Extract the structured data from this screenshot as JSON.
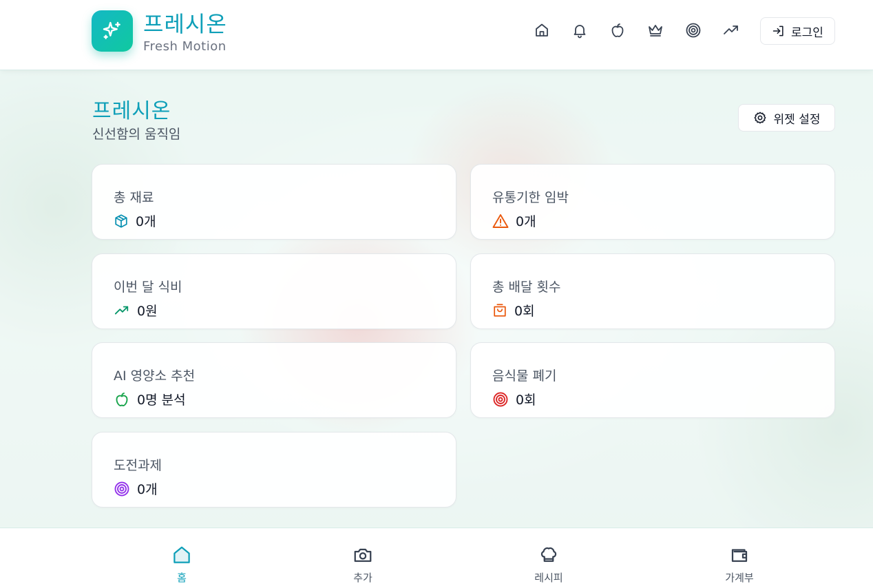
{
  "header": {
    "brand_title": "프레시온",
    "brand_subtitle": "Fresh Motion",
    "nav_icons": [
      "home-icon",
      "bell-icon",
      "apple-icon",
      "crown-icon",
      "target-icon",
      "trending-up-icon"
    ],
    "login_label": "로그인"
  },
  "page": {
    "title": "프레시온",
    "subtitle": "신선함의 움직임",
    "widget_settings_label": "위젯 설정"
  },
  "cards": [
    {
      "label": "총 재료",
      "value": "0개",
      "icon": "box-icon",
      "color": "#0891b2"
    },
    {
      "label": "유통기한 임박",
      "value": "0개",
      "icon": "warning-icon",
      "color": "#ea580c"
    },
    {
      "label": "이번 달 식비",
      "value": "0원",
      "icon": "trending-up-icon",
      "color": "#059669"
    },
    {
      "label": "총 배달 횟수",
      "value": "0회",
      "icon": "shopping-bag-icon",
      "color": "#ea580c"
    },
    {
      "label": "AI 영양소 추천",
      "value": "0명 분석",
      "icon": "apple-icon",
      "color": "#16a34a"
    },
    {
      "label": "음식물 폐기",
      "value": "0회",
      "icon": "target-icon",
      "color": "#dc2626"
    },
    {
      "label": "도전과제",
      "value": "0개",
      "icon": "target-icon",
      "color": "#9333ea"
    }
  ],
  "bottom_nav": [
    {
      "label": "홈",
      "icon": "home-icon",
      "active": true
    },
    {
      "label": "추가",
      "icon": "camera-icon",
      "active": false
    },
    {
      "label": "레시피",
      "icon": "chef-hat-icon",
      "active": false
    },
    {
      "label": "가계부",
      "icon": "wallet-icon",
      "active": false
    }
  ],
  "colors": {
    "accent": "#0e9fb8",
    "logo_gradient_start": "#14b8c4",
    "logo_gradient_end": "#10c9a0"
  }
}
